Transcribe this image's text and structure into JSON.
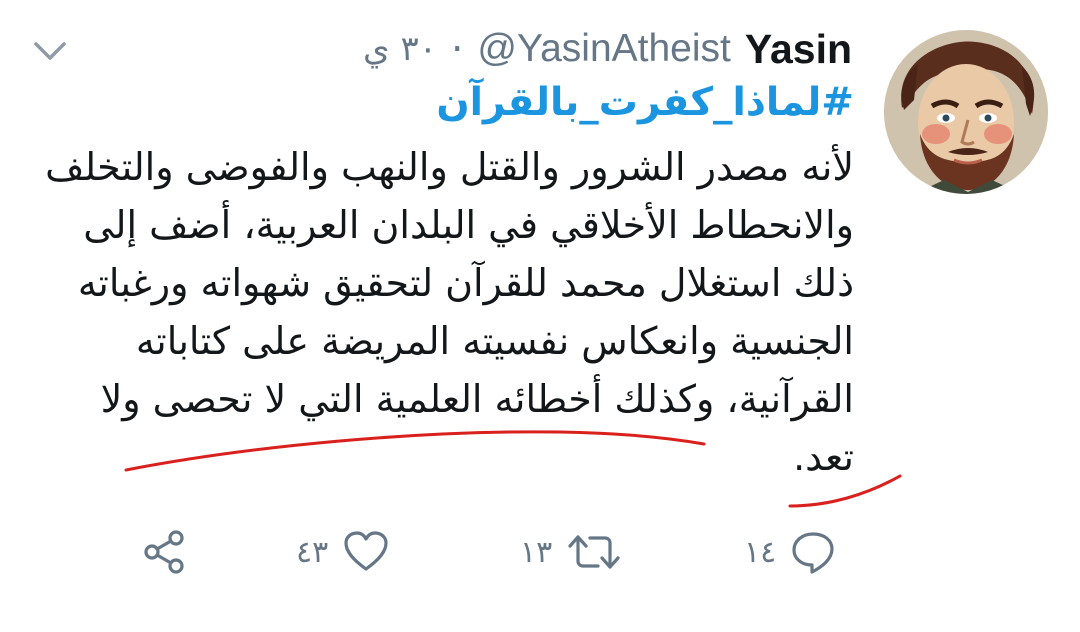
{
  "tweet": {
    "author": {
      "display_name": "Yasin",
      "handle": "@YasinAtheist",
      "avatar_icon": "avatar-portrait"
    },
    "separator": "·",
    "time": "٣٠ ي",
    "hashtag": "#لماذا_كفرت_بالقرآن",
    "lines": [
      "لأنه مصدر الشرور والقتل والنهب والفوضى والتخلف",
      "والانحطاط الأخلاقي في البلدان العربية، أضف إلى",
      "ذلك استغلال محمد للقرآن لتحقيق شهواته ورغباته",
      "الجنسية وانعكاس نفسيته المريضة على كتاباته",
      "القرآنية، وكذلك أخطائه العلمية التي لا تحصى ولا",
      "تعد."
    ],
    "actions": {
      "reply": {
        "icon": "reply-icon",
        "count": "١٤"
      },
      "retweet": {
        "icon": "retweet-icon",
        "count": "١٣"
      },
      "like": {
        "icon": "heart-icon",
        "count": "٤٣"
      },
      "share": {
        "icon": "share-icon"
      }
    }
  },
  "colors": {
    "text": "#14171a",
    "secondary": "#657786",
    "hashtag": "#1b95e0",
    "annotation": "#d9201c"
  }
}
